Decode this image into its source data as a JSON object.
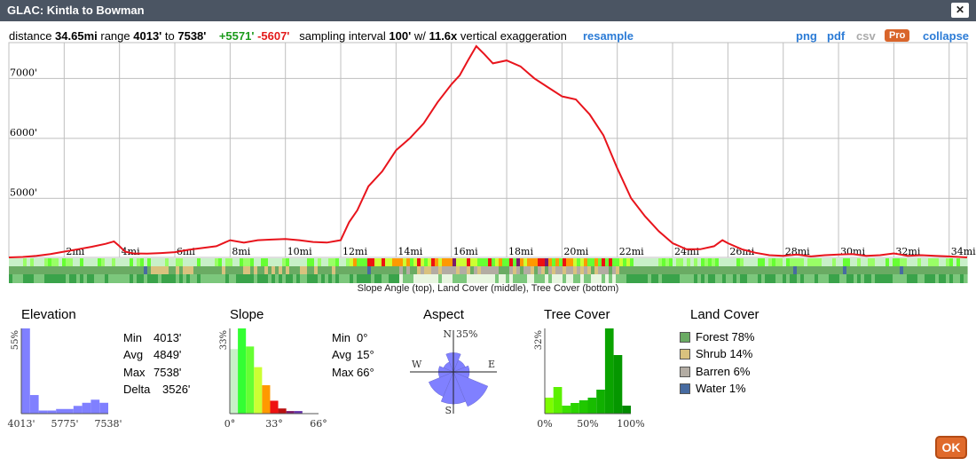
{
  "window": {
    "title": "GLAC: Kintla to Bowman",
    "close_label": "✕"
  },
  "stats": {
    "distance_label": "distance",
    "distance": "34.65mi",
    "range_label": "range",
    "range_min": "4013'",
    "range_to": "to",
    "range_max": "7538'",
    "gain": "+5571'",
    "loss": "-5607'",
    "sampling_label": "sampling interval",
    "sampling": "100'",
    "with_label": "w/",
    "exaggeration": "11.6x",
    "exaggeration_label": "vertical exaggeration",
    "resample": "resample"
  },
  "toolbar": {
    "png": "png",
    "pdf": "pdf",
    "csv": "csv",
    "pro": "Pro",
    "collapse": "collapse"
  },
  "colors": {
    "profile": "#e8141c",
    "grid": "#bfbfbf",
    "gain": "#1a9a1a",
    "loss": "#e31a1a",
    "link": "#2b7bd6",
    "histogram": "#8080ff",
    "ok": "#e06a2b"
  },
  "bands_caption": "Slope Angle (top), Land Cover (middle), Tree Cover (bottom)",
  "chart_data": [
    {
      "type": "line",
      "name": "elevation-profile",
      "xlim": [
        0,
        34.65
      ],
      "ylim": [
        4013,
        7538
      ],
      "x_ticks": [
        "2mi",
        "4mi",
        "6mi",
        "8mi",
        "10mi",
        "12mi",
        "14mi",
        "16mi",
        "18mi",
        "20mi",
        "22mi",
        "24mi",
        "26mi",
        "28mi",
        "30mi",
        "32mi",
        "34mi"
      ],
      "y_ticks": [
        "5000'",
        "6000'",
        "7000'"
      ],
      "grid": true,
      "x": [
        0,
        0.5,
        1,
        1.5,
        2,
        2.5,
        3,
        3.5,
        3.8,
        4,
        4.2,
        4.5,
        5,
        5.5,
        6,
        6.5,
        7,
        7.5,
        8,
        8.5,
        9,
        9.5,
        10,
        10.5,
        11,
        11.5,
        12,
        12.3,
        12.6,
        13,
        13.5,
        14,
        14.5,
        15,
        15.5,
        16,
        16.3,
        16.6,
        16.9,
        17.2,
        17.5,
        18,
        18.5,
        19,
        19.5,
        20,
        20.5,
        21,
        21.5,
        22,
        22.5,
        23,
        23.5,
        24,
        24.5,
        25,
        25.5,
        25.8,
        26,
        26.5,
        27,
        27.5,
        28,
        28.5,
        29,
        29.5,
        30,
        30.5,
        31,
        31.5,
        32,
        32.5,
        33,
        33.5,
        34,
        34.65
      ],
      "y": [
        4013,
        4020,
        4040,
        4070,
        4110,
        4150,
        4190,
        4240,
        4280,
        4200,
        4110,
        4080,
        4075,
        4085,
        4100,
        4140,
        4170,
        4200,
        4300,
        4260,
        4300,
        4310,
        4320,
        4300,
        4270,
        4260,
        4300,
        4600,
        4800,
        5200,
        5450,
        5800,
        6000,
        6250,
        6600,
        6900,
        7050,
        7300,
        7538,
        7400,
        7250,
        7300,
        7200,
        7000,
        6850,
        6700,
        6650,
        6400,
        6050,
        5500,
        5000,
        4700,
        4450,
        4250,
        4150,
        4150,
        4200,
        4300,
        4250,
        4150,
        4090,
        4050,
        4040,
        4060,
        4030,
        4050,
        4060,
        4070,
        4040,
        4050,
        4080,
        4040,
        4050,
        4040,
        4030,
        4013
      ]
    },
    {
      "type": "bar",
      "name": "Elevation",
      "values": [
        55,
        12,
        2,
        2,
        3,
        3,
        5,
        7,
        9,
        7
      ],
      "ymax_label": "55%",
      "x_ticks": [
        "4013'",
        "5775'",
        "7538'"
      ],
      "stats": [
        {
          "k": "Min",
          "v": "4013'"
        },
        {
          "k": "Avg",
          "v": "4849'"
        },
        {
          "k": "Max",
          "v": "7538'"
        },
        {
          "k": "Delta",
          "v": "3526'"
        }
      ]
    },
    {
      "type": "bar",
      "name": "Slope",
      "values": [
        25,
        33,
        26,
        18,
        11,
        5,
        2,
        1,
        1,
        0,
        0
      ],
      "colors": [
        "#c8f0c8",
        "#33ff33",
        "#66ff33",
        "#ccff33",
        "#ff9900",
        "#ee1111",
        "#bb1111",
        "#7a1a6b",
        "#6633aa",
        "#ffffff",
        "#ffffff"
      ],
      "ymax_label": "33%",
      "x_ticks": [
        "0°",
        "33°",
        "66°"
      ],
      "stats": [
        {
          "k": "Min",
          "v": "0°"
        },
        {
          "k": "Avg",
          "v": "15°"
        },
        {
          "k": "Max",
          "v": "66°"
        }
      ]
    },
    {
      "type": "rose",
      "name": "Aspect",
      "directions": [
        "N",
        "NE",
        "E",
        "SE",
        "S",
        "SW",
        "W",
        "NW"
      ],
      "values": [
        18,
        12,
        15,
        35,
        30,
        25,
        14,
        10
      ],
      "max_label": "35%",
      "labels": {
        "n": "N",
        "e": "E",
        "s": "S",
        "w": "W"
      }
    },
    {
      "type": "bar",
      "name": "Tree Cover",
      "values": [
        6,
        10,
        3,
        4,
        5,
        6,
        9,
        32,
        22,
        3
      ],
      "colors": [
        "#7dfc00",
        "#5bf000",
        "#3ce000",
        "#2bd400",
        "#20c800",
        "#18bd00",
        "#10b000",
        "#0aa300",
        "#059700",
        "#028a00"
      ],
      "ymax_label": "32%",
      "x_ticks": [
        "0%",
        "50%",
        "100%"
      ]
    },
    {
      "type": "legend",
      "name": "Land Cover",
      "items": [
        {
          "label": "Forest",
          "value": "78%",
          "color": "#6aab63"
        },
        {
          "label": "Shrub",
          "value": "14%",
          "color": "#d9c27e"
        },
        {
          "label": "Barren",
          "value": "6%",
          "color": "#b3aca3"
        },
        {
          "label": "Water",
          "value": "1%",
          "color": "#476ba1"
        }
      ]
    }
  ],
  "ok_label": "OK"
}
